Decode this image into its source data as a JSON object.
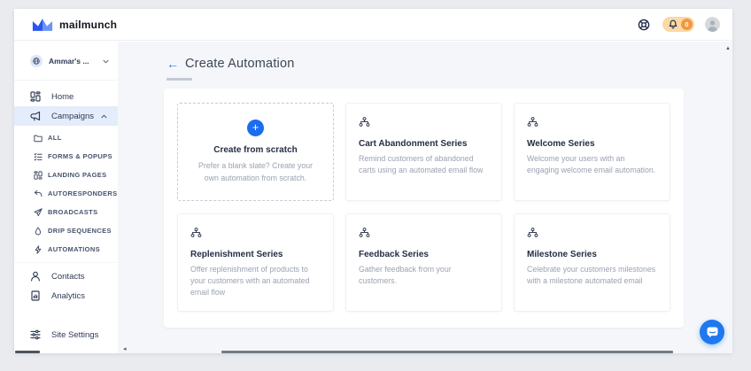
{
  "header": {
    "brand": "mailmunch",
    "help_icon": "lifebuoy-icon",
    "notifications": {
      "icon": "bell-icon",
      "count": "0"
    },
    "avatar_icon": "user-avatar-icon"
  },
  "sidebar": {
    "workspace": "Ammar's ...",
    "home": "Home",
    "campaigns": "Campaigns",
    "campaign_sub": [
      "ALL",
      "FORMS & POPUPS",
      "LANDING PAGES",
      "AUTORESPONDERS",
      "BROADCASTS",
      "DRIP SEQUENCES",
      "AUTOMATIONS"
    ],
    "contacts": "Contacts",
    "analytics": "Analytics",
    "site_settings": "Site Settings"
  },
  "main": {
    "title": "Create Automation",
    "back_icon": "back-arrow-icon",
    "cards": [
      {
        "icon": "plus-icon",
        "title": "Create from scratch",
        "description": "Prefer a blank slate? Create your own automation from scratch."
      },
      {
        "icon": "workflow-icon",
        "title": "Cart Abandonment Series",
        "description": "Remind customers of abandoned carts using an automated email flow"
      },
      {
        "icon": "workflow-icon",
        "title": "Welcome Series",
        "description": "Welcome your users with an engaging welcome email automation."
      },
      {
        "icon": "workflow-icon",
        "title": "Replenishment Series",
        "description": "Offer replenishment of products to your customers with an automated email flow"
      },
      {
        "icon": "workflow-icon",
        "title": "Feedback Series",
        "description": "Gather feedback from your customers."
      },
      {
        "icon": "workflow-icon",
        "title": "Milestone Series",
        "description": "Celebrate your customers milestones with a milestone automated email"
      }
    ]
  },
  "colors": {
    "accent_blue": "#1a6cf0",
    "badge_orange": "#f2993e",
    "badge_pill_bg": "#fbd8a6",
    "active_nav_bg": "#e4edfb",
    "content_bg": "#f4f6f9"
  }
}
